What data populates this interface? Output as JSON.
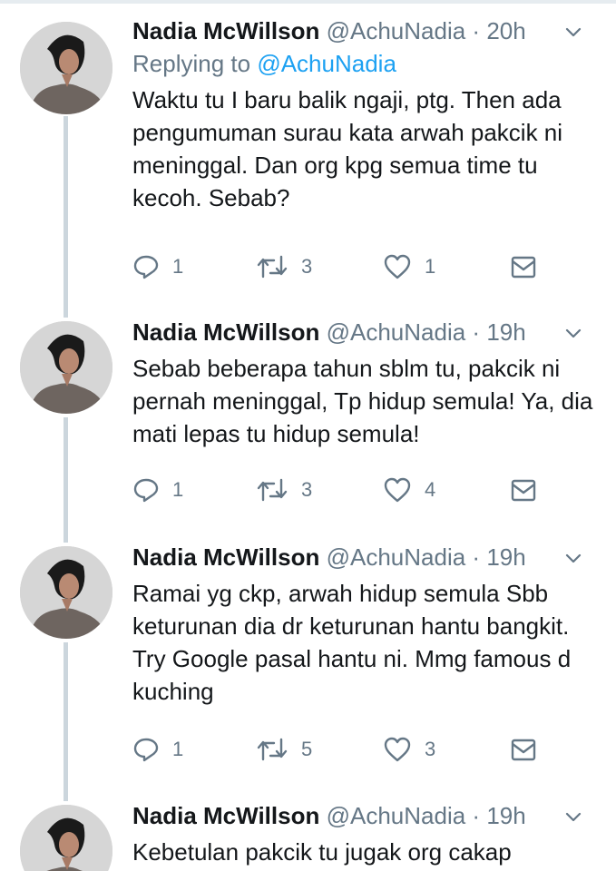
{
  "tweets": [
    {
      "name": "Nadia McWillson",
      "handle": "@AchuNadia",
      "dot": "·",
      "time": "20h",
      "replying_prefix": "Replying to",
      "replying_handle": "@AchuNadia",
      "text": "Waktu tu I baru balik ngaji, ptg. Then ada pengumuman surau kata arwah pakcik ni meninggal. Dan  org kpg semua time tu kecoh. Sebab?",
      "replies": "1",
      "retweets": "3",
      "likes": "1"
    },
    {
      "name": "Nadia McWillson",
      "handle": "@AchuNadia",
      "dot": "·",
      "time": "19h",
      "text": "Sebab beberapa tahun sblm tu, pakcik ni pernah meninggal, Tp hidup semula! Ya, dia mati lepas tu hidup semula!",
      "replies": "1",
      "retweets": "3",
      "likes": "4"
    },
    {
      "name": "Nadia McWillson",
      "handle": "@AchuNadia",
      "dot": "·",
      "time": "19h",
      "text": "Ramai yg ckp, arwah hidup semula Sbb keturunan dia dr keturunan hantu bangkit. Try Google pasal hantu ni. Mmg famous d kuching",
      "replies": "1",
      "retweets": "5",
      "likes": "3"
    },
    {
      "name": "Nadia McWillson",
      "handle": "@AchuNadia",
      "dot": "·",
      "time": "19h",
      "text": "Kebetulan pakcik tu jugak org cakap"
    }
  ],
  "icons": {
    "reply": "reply-icon",
    "retweet": "retweet-icon",
    "like": "heart-icon",
    "dm": "envelope-icon",
    "more": "chevron-down-icon"
  },
  "colors": {
    "text": "#14171a",
    "secondary": "#657786",
    "link": "#1da1f2",
    "thread_line": "#ccd6dd"
  }
}
